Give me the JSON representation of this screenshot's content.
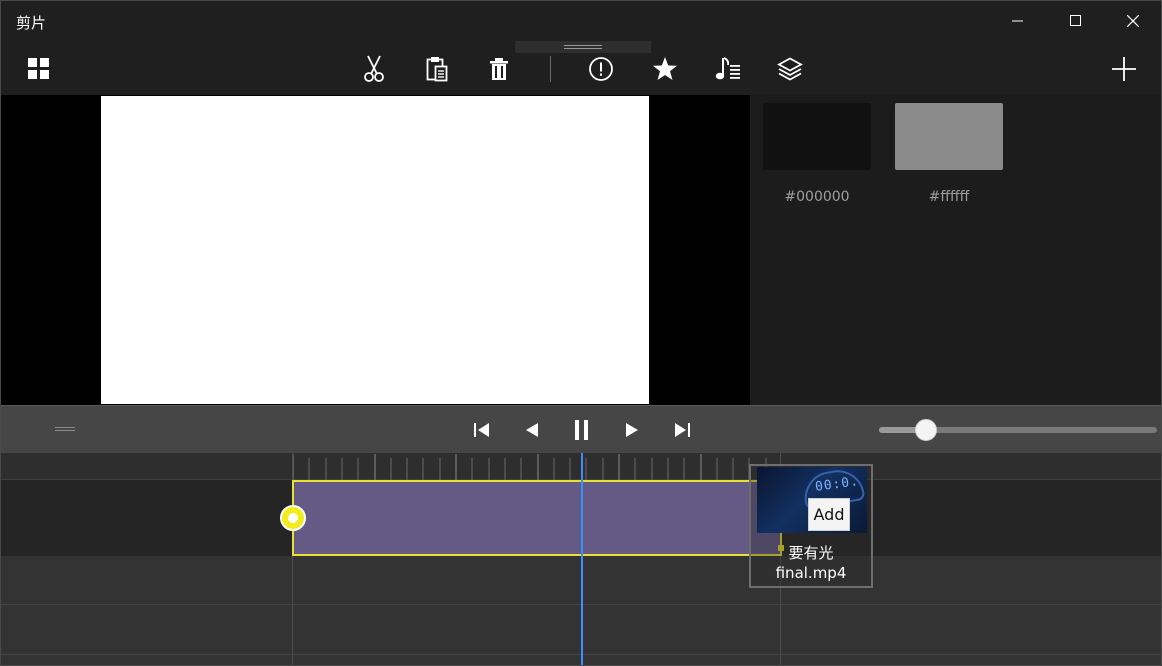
{
  "window": {
    "title": "剪片"
  },
  "toolbar": {
    "icons": [
      "grid-icon",
      "scissors-icon",
      "clipboard-icon",
      "trash-icon",
      "alert-icon",
      "star-icon",
      "music-icon",
      "layers-icon",
      "plus-icon"
    ]
  },
  "colors": {
    "swatches": [
      {
        "hex": "#000000",
        "label": "#000000",
        "fill": "#111111"
      },
      {
        "hex": "#ffffff",
        "label": "#ffffff",
        "fill": "#8a8a8a"
      }
    ],
    "accent": "#3b8eff",
    "clip_border": "#e8e22e",
    "clip_fill": "#655985"
  },
  "transport": {
    "zoom_level": 0.14
  },
  "media": {
    "add_label": "Add",
    "name": "要有光\nfinal.mp4",
    "name_line1": "要有光",
    "name_line2": "final.mp4",
    "thumb_text": "00:0."
  }
}
